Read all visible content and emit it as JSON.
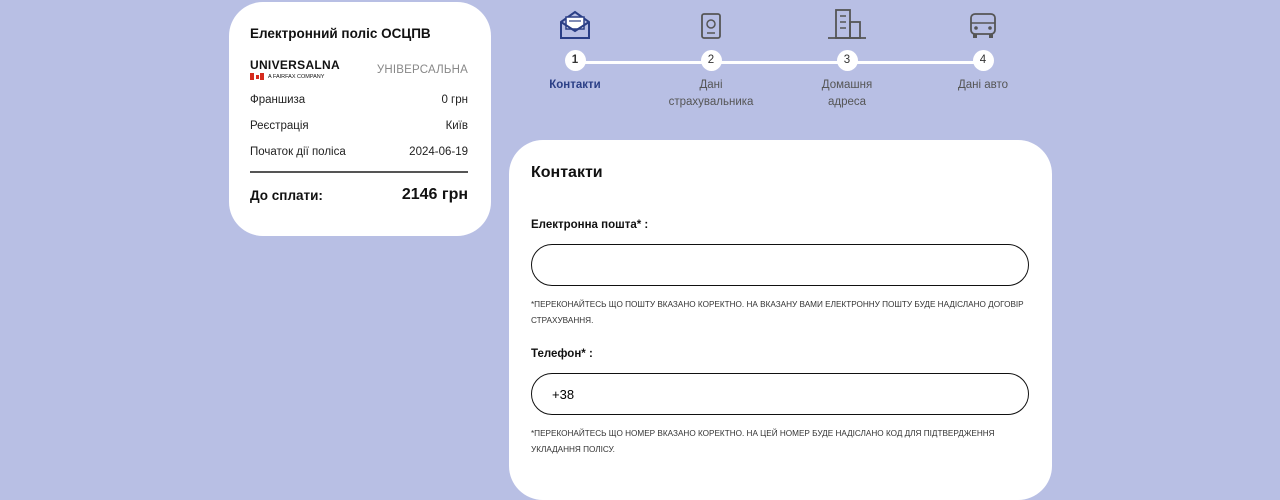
{
  "summary": {
    "title": "Електронний поліс ОСЦПВ",
    "logo_text": "UNIVERSALNA",
    "logo_subtext": "A FAIRFAX COMPANY",
    "insurer_name": "УНІВЕРСАЛЬНА",
    "rows": [
      {
        "label": "Франшиза",
        "value": "0 грн"
      },
      {
        "label": "Реєстрація",
        "value": "Київ"
      },
      {
        "label": "Початок дії поліса",
        "value": "2024-06-19"
      }
    ],
    "total_label": "До сплати:",
    "total_value": "2146 грн"
  },
  "steps": [
    {
      "number": "1",
      "label": "Контакти",
      "icon": "envelope-icon",
      "active": true
    },
    {
      "number": "2",
      "label": "Дані страхувальника",
      "icon": "passport-icon",
      "active": false
    },
    {
      "number": "3",
      "label": "Домашня адреса",
      "icon": "buildings-icon",
      "active": false
    },
    {
      "number": "4",
      "label": "Дані авто",
      "icon": "car-icon",
      "active": false
    }
  ],
  "colors": {
    "background": "#b8bfe4",
    "accent": "#2b3f86"
  },
  "form": {
    "title": "Контакти",
    "email_label": "Електронна пошта* :",
    "email_value": "",
    "email_note": "*ПЕРЕКОНАЙТЕСЬ ЩО ПОШТУ ВКАЗАНО КОРЕКТНО. НА ВКАЗАНУ ВАМИ ЕЛЕКТРОННУ ПОШТУ БУДЕ НАДІСЛАНО ДОГОВІР СТРАХУВАННЯ.",
    "phone_label": "Телефон* :",
    "phone_value": "+38",
    "phone_note": "*ПЕРЕКОНАЙТЕСЬ ЩО НОМЕР ВКАЗАНО КОРЕКТНО. НА ЦЕЙ НОМЕР БУДЕ НАДІСЛАНО КОД ДЛЯ ПІДТВЕРДЖЕННЯ УКЛАДАННЯ ПОЛІСУ."
  }
}
